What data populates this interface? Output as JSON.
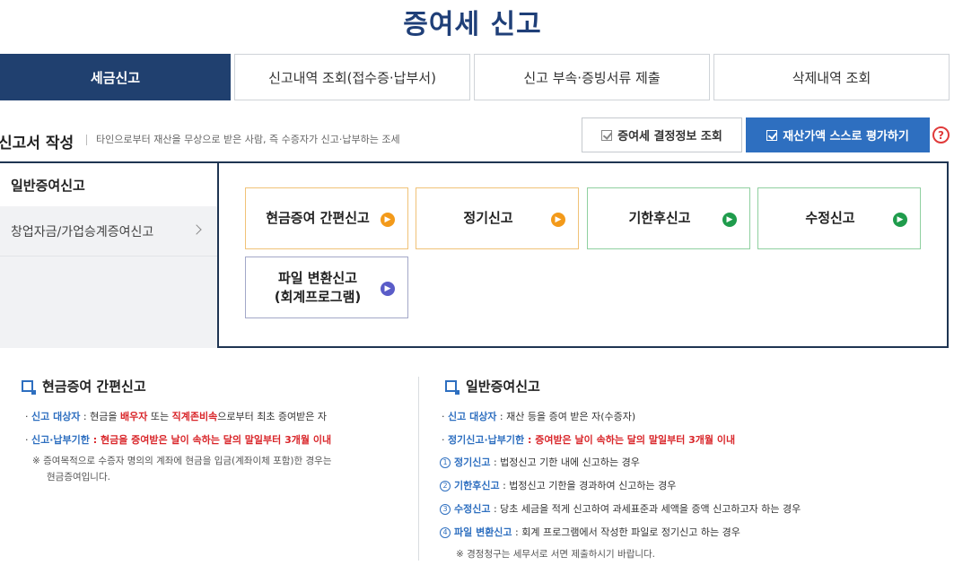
{
  "page": {
    "title": "증여세 신고"
  },
  "tabs": [
    {
      "label": "세금신고",
      "active": true
    },
    {
      "label": "신고내역 조회(접수증·납부서)"
    },
    {
      "label": "신고 부속·증빙서류 제출"
    },
    {
      "label": "삭제내역 조회"
    }
  ],
  "write": {
    "title": "신고서 작성",
    "desc": "타인으로부터 재산을 무상으로 받은 사람, 즉 수증자가 신고·납부하는 조세"
  },
  "buttons": {
    "lookup": "증여세 결정정보 조회",
    "self_assess": "재산가액 스스로 평가하기",
    "help": "?"
  },
  "side": {
    "general": "일반증여신고",
    "startup": "창업자금/가업승계증여신고"
  },
  "cards": {
    "cash": "현금증여 간편신고",
    "regular": "정기신고",
    "late": "기한후신고",
    "amend": "수정신고",
    "file_line1": "파일 변환신고",
    "file_line2": "(회계프로그램)"
  },
  "colors": {
    "navy": "#20406f",
    "blue": "#2e6fc0",
    "orange": "#f39a1a",
    "green": "#1f9c4c",
    "purple": "#5a5cc8",
    "red": "#d9262a"
  },
  "cash_info": {
    "title": "현금증여 간편신고",
    "target_label": "신고 대상자",
    "target_pre": " : 현금을 ",
    "target_em1": "배우자",
    "target_mid": " 또는 ",
    "target_em2": "직계존비속",
    "target_post": "으로부터 최초 증여받은 자",
    "deadline_label": "신고·납부기한",
    "deadline_text": " : 현금을 증여받은 날이 속하는 달의 말일부터 3개월 이내",
    "note1": "※ 증여목적으로 수증자 명의의 계좌에 현금을 입금(계좌이체 포함)한 경우는",
    "note2": "현금증여입니다."
  },
  "general_info": {
    "title": "일반증여신고",
    "target_label": "신고 대상자",
    "target_text": " : 재산 등을 증여 받은 자(수증자)",
    "deadline_label": "정기신고·납부기한",
    "deadline_text": " : 증여받은 날이 속하는 달의 말일부터 3개월 이내",
    "items": [
      {
        "num": "1",
        "label": "정기신고",
        "text": " : 법정신고 기한 내에 신고하는 경우"
      },
      {
        "num": "2",
        "label": "기한후신고",
        "text": " : 법정신고 기한을 경과하여 신고하는 경우"
      },
      {
        "num": "3",
        "label": "수정신고",
        "text": " : 당초 세금을 적게 신고하여 과세표준과 세액을 증액 신고하고자 하는 경우"
      },
      {
        "num": "4",
        "label": "파일 변환신고",
        "text": " : 회계 프로그램에서 작성한 파일로 정기신고 하는 경우"
      }
    ],
    "note": "※ 경정청구는 세무서로 서면 제출하시기 바랍니다."
  }
}
